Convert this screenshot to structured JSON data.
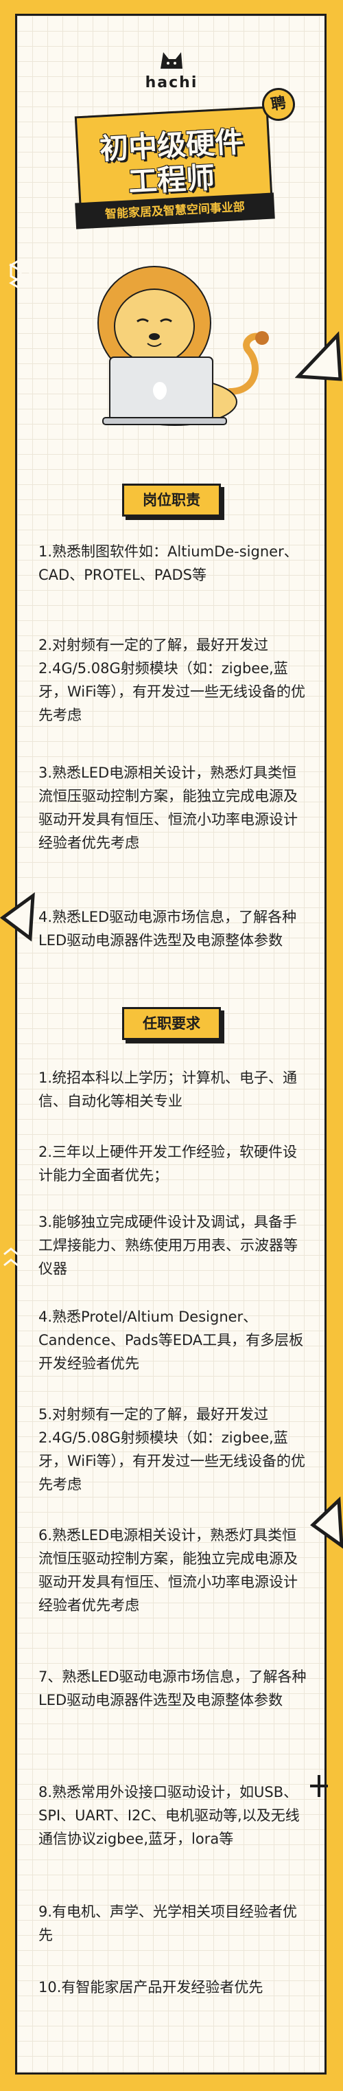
{
  "brand": {
    "name": "hachi"
  },
  "badge": {
    "text": "聘"
  },
  "title": {
    "line1": "初中级硬件",
    "line2": "工程师"
  },
  "subtitle": "智能家居及智慧空间事业部",
  "colors": {
    "accent": "#f7c23a",
    "ink": "#1d1d1d",
    "paper": "#fdfaf2"
  },
  "sections": {
    "duties": {
      "heading": "岗位职责",
      "items": [
        "1.熟悉制图软件如：AltiumDe-signer、CAD、PROTEL、PADS等",
        "2.对射频有一定的了解，最好开发过2.4G/5.08G射频模块（如：zigbee,蓝牙，WiFi等），有开发过一些无线设备的优先考虑",
        "3.熟悉LED电源相关设计，熟悉灯具类恒流恒压驱动控制方案，能独立完成电源及驱动开发具有恒压、恒流小功率电源设计经验者优先考虑",
        "4.熟悉LED驱动电源市场信息，了解各种LED驱动电源器件选型及电源整体参数"
      ]
    },
    "requirements": {
      "heading": "任职要求",
      "items": [
        "1.统招本科以上学历；计算机、电子、通信、自动化等相关专业",
        "2.三年以上硬件开发工作经验，软硬件设计能力全面者优先；",
        "3.能够独立完成硬件设计及调试，具备手工焊接能力、熟练使用万用表、示波器等仪器",
        "4.熟悉Protel/Altium Designer、Candence、Pads等EDA工具，有多层板开发经验者优先",
        "5.对射频有一定的了解，最好开发过2.4G/5.08G射频模块（如：zigbee,蓝牙，WiFi等），有开发过一些无线设备的优先考虑",
        "6.熟悉LED电源相关设计，熟悉灯具类恒流恒压驱动控制方案，能独立完成电源及驱动开发具有恒压、恒流小功率电源设计经验者优先考虑",
        "7、熟悉LED驱动电源市场信息，了解各种LED驱动电源器件选型及电源整体参数",
        "8.熟悉常用外设接口驱动设计，如USB、SPI、UART、I2C、电机驱动等,以及无线通信协议zigbee,蓝牙，lora等",
        "9.有电机、声学、光学相关项目经验者优先",
        "10.有智能家居产品开发经验者优先"
      ]
    }
  }
}
